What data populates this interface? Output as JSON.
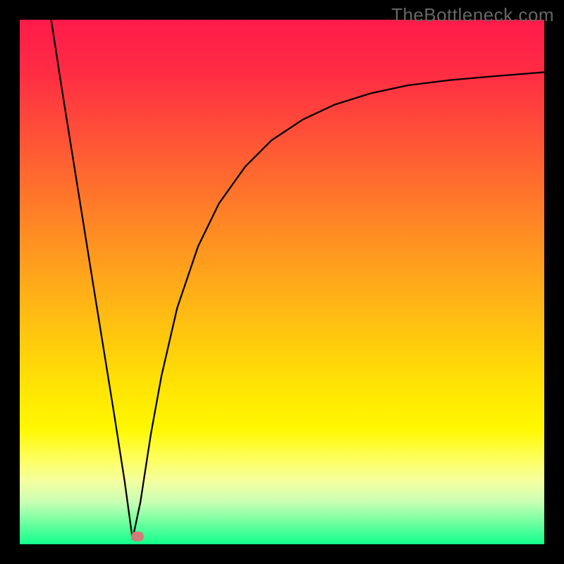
{
  "watermark": "TheBottleneck.com",
  "plot": {
    "size": 744,
    "gradient_stops": [
      {
        "offset": 0.0,
        "color": "#ff1a4a"
      },
      {
        "offset": 0.1,
        "color": "#ff2c44"
      },
      {
        "offset": 0.25,
        "color": "#ff5a34"
      },
      {
        "offset": 0.4,
        "color": "#ff8a24"
      },
      {
        "offset": 0.55,
        "color": "#ffb814"
      },
      {
        "offset": 0.7,
        "color": "#ffe404"
      },
      {
        "offset": 0.78,
        "color": "#fff800"
      },
      {
        "offset": 0.84,
        "color": "#feff63"
      },
      {
        "offset": 0.88,
        "color": "#f4ffa0"
      },
      {
        "offset": 0.92,
        "color": "#c8ffb4"
      },
      {
        "offset": 0.96,
        "color": "#6cff9e"
      },
      {
        "offset": 1.0,
        "color": "#12ff8c"
      }
    ],
    "baseline_y": 744,
    "marker": {
      "x_pct": 0.225,
      "y_pct": 0.985
    }
  },
  "chart_data": {
    "type": "line",
    "title": "",
    "xlabel": "",
    "ylabel": "",
    "xlim": [
      0,
      1
    ],
    "ylim": [
      0,
      1
    ],
    "legend": false,
    "grid": false,
    "note": "Axes are unlabeled in the source image; x and y are normalized fractions of the plot area (origin bottom-left). Curve descends steeply from top-left to a minimum near x≈0.215 at y≈0, then rises and asymptotically flattens toward y≈0.9 at the right edge.",
    "series": [
      {
        "name": "curve",
        "x": [
          0.06,
          0.08,
          0.1,
          0.12,
          0.14,
          0.16,
          0.18,
          0.2,
          0.215,
          0.23,
          0.25,
          0.27,
          0.3,
          0.34,
          0.38,
          0.43,
          0.48,
          0.54,
          0.6,
          0.67,
          0.74,
          0.82,
          0.9,
          1.0
        ],
        "y": [
          1.0,
          0.87,
          0.745,
          0.62,
          0.495,
          0.372,
          0.248,
          0.12,
          0.01,
          0.08,
          0.21,
          0.32,
          0.45,
          0.568,
          0.65,
          0.72,
          0.77,
          0.81,
          0.838,
          0.86,
          0.875,
          0.885,
          0.892,
          0.9
        ]
      }
    ],
    "marker": {
      "x": 0.225,
      "y": 0.015,
      "color": "#d27c7a"
    },
    "background": "vertical rainbow gradient red→orange→yellow→green"
  }
}
